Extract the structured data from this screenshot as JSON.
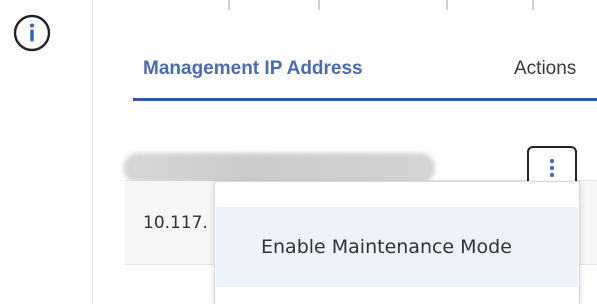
{
  "table": {
    "columns": {
      "ip": "Management IP Address",
      "actions": "Actions"
    },
    "rows": [
      {
        "ip": ""
      },
      {
        "ip": "10.117."
      }
    ]
  },
  "actions_menu": {
    "items": [
      {
        "label": "Enable Maintenance Mode"
      }
    ]
  },
  "icons": {
    "info": "info-icon",
    "actions": "more-vertical-icon"
  },
  "colors": {
    "accent": "#3557a8",
    "header_ip_text": "#4a6bb0",
    "menu_item_highlight": "#eef2fa"
  }
}
